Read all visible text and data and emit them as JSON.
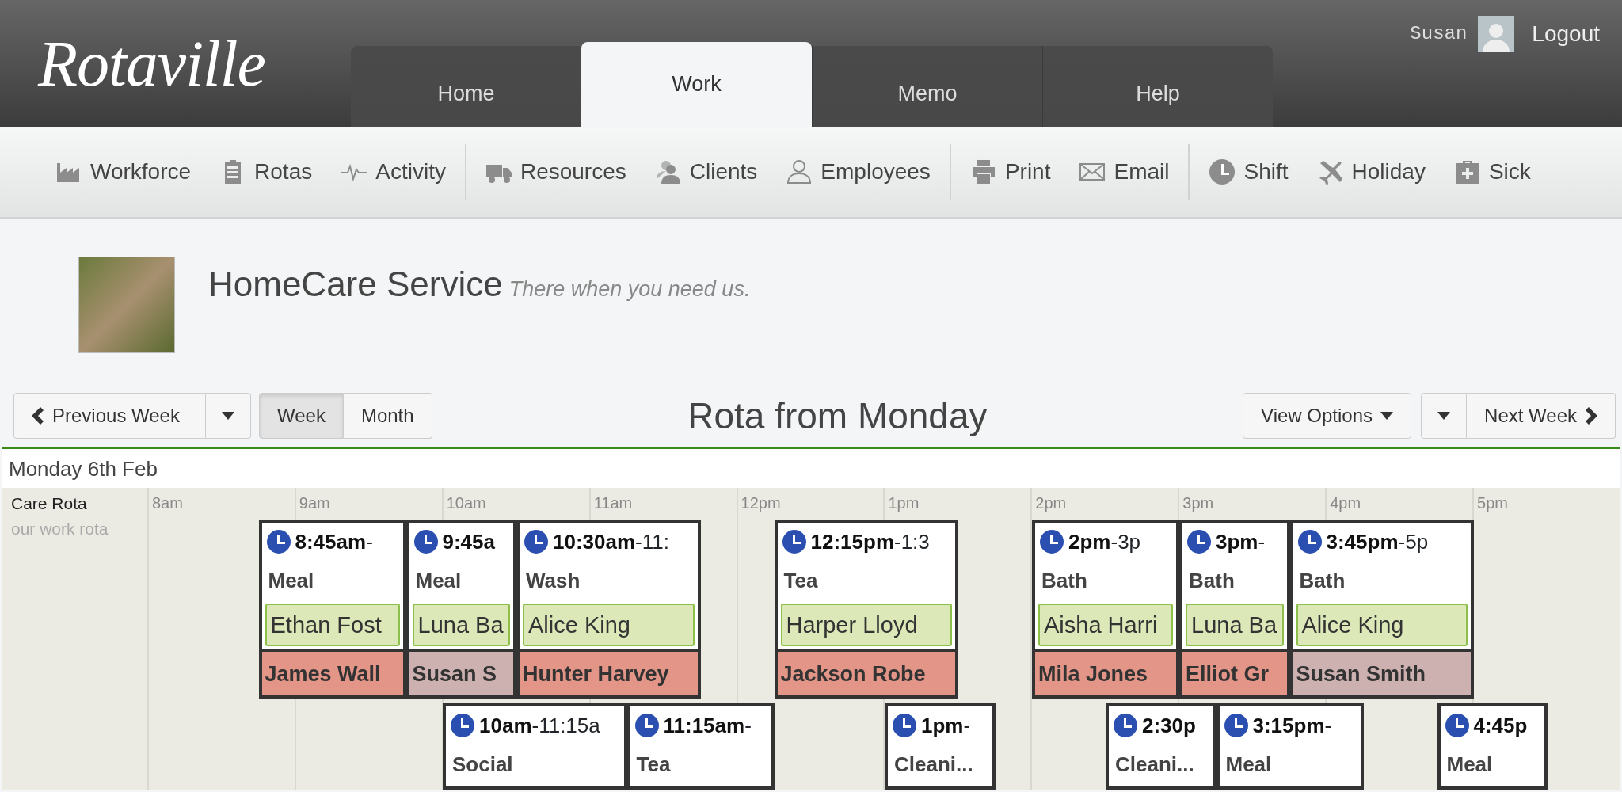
{
  "header": {
    "logo": "Rotaville",
    "tabs": [
      {
        "label": "Home",
        "selected": false
      },
      {
        "label": "Work",
        "selected": true
      },
      {
        "label": "Memo",
        "selected": false
      },
      {
        "label": "Help",
        "selected": false
      }
    ],
    "user": "Susan",
    "logout": "Logout"
  },
  "toolbar": [
    [
      {
        "label": "Workforce"
      },
      {
        "label": "Rotas"
      },
      {
        "label": "Activity"
      }
    ],
    [
      {
        "label": "Resources"
      },
      {
        "label": "Clients"
      },
      {
        "label": "Employees"
      }
    ],
    [
      {
        "label": "Print"
      },
      {
        "label": "Email"
      }
    ],
    [
      {
        "label": "Shift"
      },
      {
        "label": "Holiday"
      },
      {
        "label": "Sick"
      }
    ]
  ],
  "company": {
    "name": "HomeCare Service",
    "tagline": "There when you need us."
  },
  "controls": {
    "previous": "Previous Week",
    "views": [
      {
        "label": "Week",
        "selected": true
      },
      {
        "label": "Month",
        "selected": false
      }
    ],
    "title": "Rota from Monday",
    "view_options": "View Options",
    "next": "Next Week"
  },
  "rota": {
    "date": "Monday 6th Feb",
    "name": "Care Rota",
    "note": "our work rota",
    "hours": [
      "8am",
      "9am",
      "10am",
      "11am",
      "12pm",
      "1pm",
      "2pm",
      "3pm",
      "4pm",
      "5pm"
    ],
    "lanes": [
      [
        {
          "time": "8:45am",
          "until": "-",
          "activity": "Meal",
          "client": "Ethan Fost",
          "carer": "James Wall",
          "color": "#e39588"
        },
        {
          "time": "9:45a",
          "activity": "Meal",
          "client": "Luna Ba",
          "carer": "Susan S",
          "color": "#cdb1b0"
        },
        {
          "time": "10:30am",
          "until": "-11:",
          "activity": "Wash",
          "client": "Alice King",
          "carer": "Hunter Harvey",
          "color": "#e39588"
        },
        {
          "time": "12:15pm",
          "until": "-1:3",
          "activity": "Tea",
          "client": "Harper Lloyd",
          "carer": "Jackson Robe",
          "color": "#e39588"
        },
        {
          "time": "2pm",
          "until": "-3p",
          "activity": "Bath",
          "client": "Aisha Harri",
          "carer": "Mila Jones",
          "color": "#e39588"
        },
        {
          "time": "3pm",
          "until": "-",
          "activity": "Bath",
          "client": "Luna Ba",
          "carer": "Elliot Gr",
          "color": "#e39588"
        },
        {
          "time": "3:45pm",
          "until": "-5p",
          "activity": "Bath",
          "client": "Alice King",
          "carer": "Susan Smith",
          "color": "#cdb1b0"
        }
      ],
      [
        {
          "time": "10am",
          "until": "-11:15a",
          "activity": "Social"
        },
        {
          "time": "11:15am",
          "until": "-",
          "activity": "Tea"
        },
        {
          "time": "1pm",
          "until": "-",
          "activity": "Cleani..."
        },
        {
          "time": "2:30p",
          "activity": "Cleani..."
        },
        {
          "time": "3:15pm",
          "until": "-",
          "activity": "Meal"
        },
        {
          "time": "4:45p",
          "activity": "Meal"
        }
      ]
    ]
  }
}
